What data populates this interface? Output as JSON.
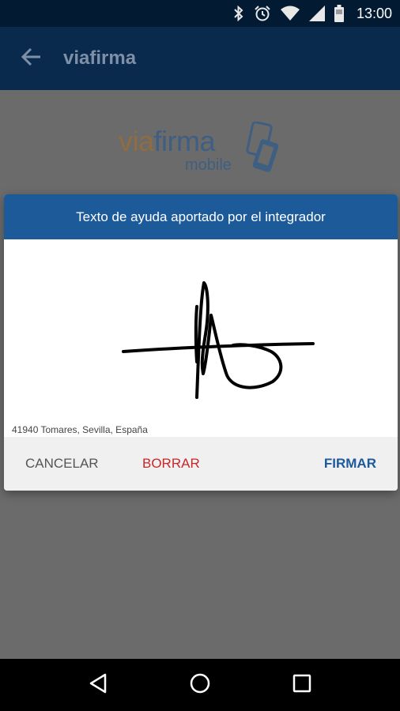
{
  "status_bar": {
    "time": "13:00",
    "icons": [
      "bluetooth-icon",
      "alarm-icon",
      "wifi-icon",
      "cell-signal-icon",
      "battery-icon"
    ]
  },
  "app_bar": {
    "title": "viafirma",
    "back_icon": "arrow-back-icon"
  },
  "logo": {
    "via": "via",
    "firma": "firma",
    "mobile": "mobile"
  },
  "dialog": {
    "title": "Texto de ayuda aportado por el integrador",
    "address": "41940 Tomares, Sevilla, España",
    "actions": {
      "cancel": "CANCELAR",
      "clear": "BORRAR",
      "sign": "FIRMAR"
    }
  },
  "nav_bar": {
    "icons": [
      "back-triangle-icon",
      "home-circle-icon",
      "recents-square-icon"
    ]
  },
  "colors": {
    "status_bar": "#031a33",
    "app_bar": "#0a2a4d",
    "dialog_header": "#1d5a9a",
    "clear_action": "#c62828",
    "sign_action": "#1d5a9a"
  }
}
